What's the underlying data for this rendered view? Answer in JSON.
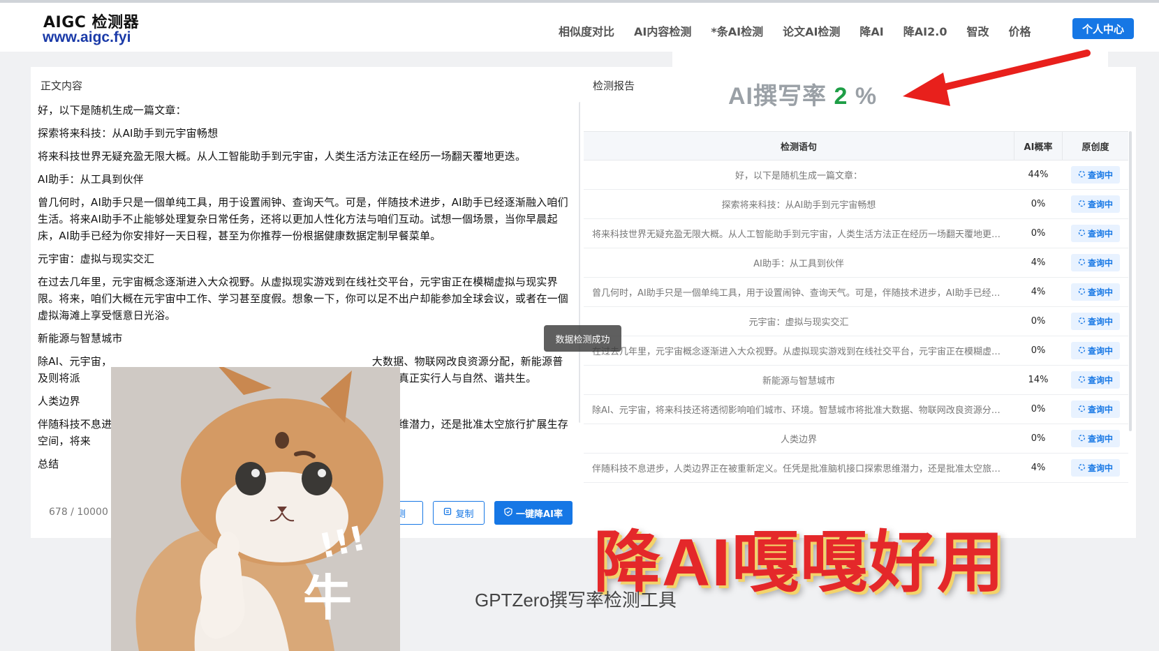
{
  "header": {
    "logo_title": "AIGC 检测器",
    "logo_url": "www.aigc.fyi",
    "nav": [
      "相似度对比",
      "AI内容检测",
      "*条AI检测",
      "论文AI检测",
      "降AI",
      "降AI2.0",
      "智改",
      "价格"
    ],
    "user_center": "个人中心"
  },
  "left_panel": {
    "title": "正文内容",
    "paragraphs": [
      "好，以下是随机生成一篇文章：",
      "探索将来科技：从AI助手到元宇宙畅想",
      "将来科技世界无疑充盈无限大概。从人工智能助手到元宇宙，人类生活方法正在经历一场翻天覆地更迭。",
      "AI助手：从工具到伙伴",
      "曾几何时，AI助手只是一個单纯工具，用于设置闹钟、查询天气。可是，伴随技术进步，AI助手已经逐渐融入咱们生活。将来AI助手不止能够处理复杂日常任务，还将以更加人性化方法与咱们互动。试想一個场景，当你早晨起床，AI助手已经为你安排好一天日程，甚至为你推荐一份根据健康数据定制早餐菜单。",
      "元宇宙：虚拟与现实交汇",
      "在过去几年里，元宇宙概念逐渐进入大众视野。从虚拟现实游戏到在线社交平台，元宇宙正在模糊虚拟与现实界限。将来，咱们大概在元宇宙中工作、学习甚至度假。想象一下，你可以足不出户却能参加全球会议，或者在一個虚拟海滩上享受惬意日光浴。",
      "新能源与智慧城市",
      "除AI、元宇宙，　　　　　　　　　　　　　　　　　　　　　　　　　大数据、物联网改良资源分配，新能源普及则将派　　　　　　　　　　　　　　　　　　　　　　　绿色环保典范，真正实行人与自然、谐共生。",
      "人类边界",
      "伴随科技不息进　　　　　　　　　　　　　　　　　　　　　　　　　　思维潜力，还是批准太空旅行扩展生存空间，将来　　　　　　　　　　　　　　　　　　　　　　　星球种族。",
      "总结"
    ],
    "counter": "678 / 10000",
    "btn_detect": "检测",
    "btn_copy": "复制",
    "btn_reduce": "一键降AI率"
  },
  "right_panel": {
    "title": "检测报告",
    "rate_label": "AI撰写率",
    "rate_value": "2",
    "rate_unit": "%",
    "col_sentence": "检测语句",
    "col_prob": "AI概率",
    "col_orig": "原创度",
    "rows": [
      {
        "s": "好，以下是随机生成一篇文章：",
        "p": "44%",
        "o": "查询中"
      },
      {
        "s": "探索将来科技：从AI助手到元宇宙畅想",
        "p": "0%",
        "o": "查询中"
      },
      {
        "s": "将来科技世界无疑充盈无限大概。从人工智能助手到元宇宙，人类生活方法正在经历一场翻天覆地更迭。",
        "p": "0%",
        "o": "查询中"
      },
      {
        "s": "AI助手：从工具到伙伴",
        "p": "4%",
        "o": "查询中"
      },
      {
        "s": "曾几何时，AI助手只是一個单纯工具，用于设置闹钟、查询天气。可是，伴随技术进步，AI助手已经逐渐融入咱们生活。",
        "p": "4%",
        "o": "查询中"
      },
      {
        "s": "元宇宙：虚拟与现实交汇",
        "p": "0%",
        "o": "查询中"
      },
      {
        "s": "在过去几年里，元宇宙概念逐渐进入大众视野。从虚拟现实游戏到在线社交平台，元宇宙正在模糊虚拟与现实界限。",
        "p": "0%",
        "o": "查询中"
      },
      {
        "s": "新能源与智慧城市",
        "p": "14%",
        "o": "查询中"
      },
      {
        "s": "除AI、元宇宙，将来科技还将透彻影响咱们城市、环境。智慧城市将批准大数据、物联网改良资源分配。",
        "p": "0%",
        "o": "查询中"
      },
      {
        "s": "人类边界",
        "p": "0%",
        "o": "查询中"
      },
      {
        "s": "伴随科技不息进步，人类边界正在被重新定义。任凭是批准脑机接口探索思维潜力，还是批准太空旅行扩展生存空间。",
        "p": "4%",
        "o": "查询中"
      }
    ]
  },
  "toast": "数据检测成功",
  "overlay_caption": "降AI嘎嘎好用",
  "section_title": "GPTZero撰写率检测工具",
  "meme_text": "牛",
  "colors": {
    "accent": "#1677e5",
    "rate_green": "#1e9e46",
    "caption_red": "#e4282a"
  }
}
